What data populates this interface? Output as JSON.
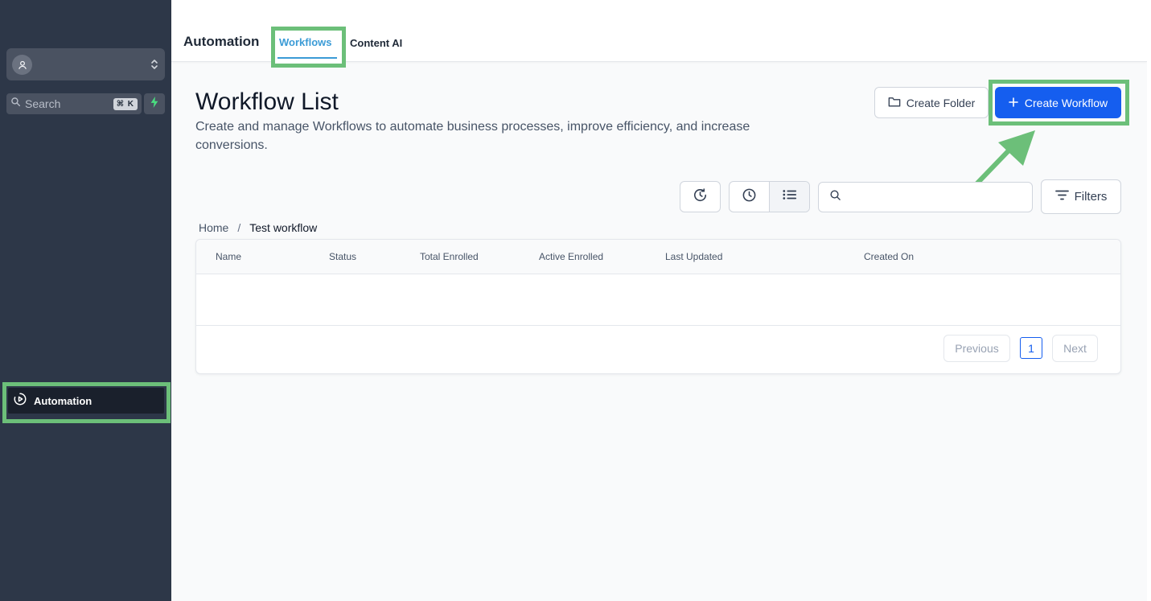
{
  "sidebar": {
    "search_label": "Search",
    "search_shortcut": "⌘ K",
    "nav_automation_label": "Automation"
  },
  "topbar": {
    "title": "Automation",
    "tabs": [
      {
        "label": "Workflows",
        "active": true
      },
      {
        "label": "Content AI",
        "active": false
      }
    ]
  },
  "header": {
    "title": "Workflow List",
    "subtitle": "Create and manage Workflows to automate business processes, improve efficiency, and increase conversions.",
    "create_folder_label": "Create Folder",
    "create_workflow_label": "Create Workflow"
  },
  "toolbar": {
    "search_value": "",
    "filters_label": "Filters"
  },
  "breadcrumb": {
    "home": "Home",
    "separator": "/",
    "current": "Test workflow"
  },
  "table": {
    "columns": [
      "Name",
      "Status",
      "Total Enrolled",
      "Active Enrolled",
      "Last Updated",
      "Created On"
    ],
    "rows": []
  },
  "pagination": {
    "previous_label": "Previous",
    "current_page": "1",
    "next_label": "Next"
  },
  "colors": {
    "sidebar_bg": "#2d3748",
    "primary": "#155eef",
    "tab_active": "#3b9bd6",
    "highlight": "#6cbf79",
    "bolt": "#4ade80"
  }
}
